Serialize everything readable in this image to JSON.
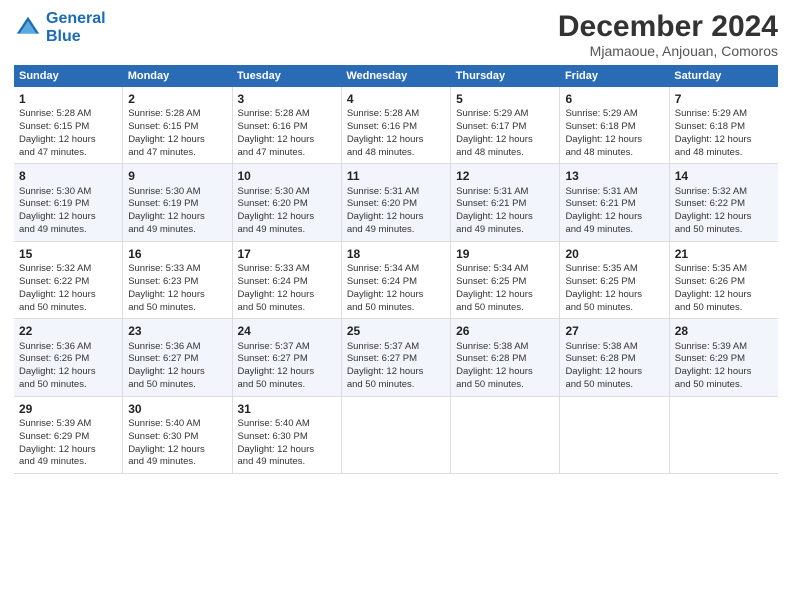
{
  "logo": {
    "line1": "General",
    "line2": "Blue"
  },
  "title": "December 2024",
  "subtitle": "Mjamaoue, Anjouan, Comoros",
  "days_header": [
    "Sunday",
    "Monday",
    "Tuesday",
    "Wednesday",
    "Thursday",
    "Friday",
    "Saturday"
  ],
  "weeks": [
    [
      {
        "day": "1",
        "info": "Sunrise: 5:28 AM\nSunset: 6:15 PM\nDaylight: 12 hours\nand 47 minutes."
      },
      {
        "day": "2",
        "info": "Sunrise: 5:28 AM\nSunset: 6:15 PM\nDaylight: 12 hours\nand 47 minutes."
      },
      {
        "day": "3",
        "info": "Sunrise: 5:28 AM\nSunset: 6:16 PM\nDaylight: 12 hours\nand 47 minutes."
      },
      {
        "day": "4",
        "info": "Sunrise: 5:28 AM\nSunset: 6:16 PM\nDaylight: 12 hours\nand 48 minutes."
      },
      {
        "day": "5",
        "info": "Sunrise: 5:29 AM\nSunset: 6:17 PM\nDaylight: 12 hours\nand 48 minutes."
      },
      {
        "day": "6",
        "info": "Sunrise: 5:29 AM\nSunset: 6:18 PM\nDaylight: 12 hours\nand 48 minutes."
      },
      {
        "day": "7",
        "info": "Sunrise: 5:29 AM\nSunset: 6:18 PM\nDaylight: 12 hours\nand 48 minutes."
      }
    ],
    [
      {
        "day": "8",
        "info": "Sunrise: 5:30 AM\nSunset: 6:19 PM\nDaylight: 12 hours\nand 49 minutes."
      },
      {
        "day": "9",
        "info": "Sunrise: 5:30 AM\nSunset: 6:19 PM\nDaylight: 12 hours\nand 49 minutes."
      },
      {
        "day": "10",
        "info": "Sunrise: 5:30 AM\nSunset: 6:20 PM\nDaylight: 12 hours\nand 49 minutes."
      },
      {
        "day": "11",
        "info": "Sunrise: 5:31 AM\nSunset: 6:20 PM\nDaylight: 12 hours\nand 49 minutes."
      },
      {
        "day": "12",
        "info": "Sunrise: 5:31 AM\nSunset: 6:21 PM\nDaylight: 12 hours\nand 49 minutes."
      },
      {
        "day": "13",
        "info": "Sunrise: 5:31 AM\nSunset: 6:21 PM\nDaylight: 12 hours\nand 49 minutes."
      },
      {
        "day": "14",
        "info": "Sunrise: 5:32 AM\nSunset: 6:22 PM\nDaylight: 12 hours\nand 50 minutes."
      }
    ],
    [
      {
        "day": "15",
        "info": "Sunrise: 5:32 AM\nSunset: 6:22 PM\nDaylight: 12 hours\nand 50 minutes."
      },
      {
        "day": "16",
        "info": "Sunrise: 5:33 AM\nSunset: 6:23 PM\nDaylight: 12 hours\nand 50 minutes."
      },
      {
        "day": "17",
        "info": "Sunrise: 5:33 AM\nSunset: 6:24 PM\nDaylight: 12 hours\nand 50 minutes."
      },
      {
        "day": "18",
        "info": "Sunrise: 5:34 AM\nSunset: 6:24 PM\nDaylight: 12 hours\nand 50 minutes."
      },
      {
        "day": "19",
        "info": "Sunrise: 5:34 AM\nSunset: 6:25 PM\nDaylight: 12 hours\nand 50 minutes."
      },
      {
        "day": "20",
        "info": "Sunrise: 5:35 AM\nSunset: 6:25 PM\nDaylight: 12 hours\nand 50 minutes."
      },
      {
        "day": "21",
        "info": "Sunrise: 5:35 AM\nSunset: 6:26 PM\nDaylight: 12 hours\nand 50 minutes."
      }
    ],
    [
      {
        "day": "22",
        "info": "Sunrise: 5:36 AM\nSunset: 6:26 PM\nDaylight: 12 hours\nand 50 minutes."
      },
      {
        "day": "23",
        "info": "Sunrise: 5:36 AM\nSunset: 6:27 PM\nDaylight: 12 hours\nand 50 minutes."
      },
      {
        "day": "24",
        "info": "Sunrise: 5:37 AM\nSunset: 6:27 PM\nDaylight: 12 hours\nand 50 minutes."
      },
      {
        "day": "25",
        "info": "Sunrise: 5:37 AM\nSunset: 6:27 PM\nDaylight: 12 hours\nand 50 minutes."
      },
      {
        "day": "26",
        "info": "Sunrise: 5:38 AM\nSunset: 6:28 PM\nDaylight: 12 hours\nand 50 minutes."
      },
      {
        "day": "27",
        "info": "Sunrise: 5:38 AM\nSunset: 6:28 PM\nDaylight: 12 hours\nand 50 minutes."
      },
      {
        "day": "28",
        "info": "Sunrise: 5:39 AM\nSunset: 6:29 PM\nDaylight: 12 hours\nand 50 minutes."
      }
    ],
    [
      {
        "day": "29",
        "info": "Sunrise: 5:39 AM\nSunset: 6:29 PM\nDaylight: 12 hours\nand 49 minutes."
      },
      {
        "day": "30",
        "info": "Sunrise: 5:40 AM\nSunset: 6:30 PM\nDaylight: 12 hours\nand 49 minutes."
      },
      {
        "day": "31",
        "info": "Sunrise: 5:40 AM\nSunset: 6:30 PM\nDaylight: 12 hours\nand 49 minutes."
      },
      {
        "day": "",
        "info": ""
      },
      {
        "day": "",
        "info": ""
      },
      {
        "day": "",
        "info": ""
      },
      {
        "day": "",
        "info": ""
      }
    ]
  ]
}
